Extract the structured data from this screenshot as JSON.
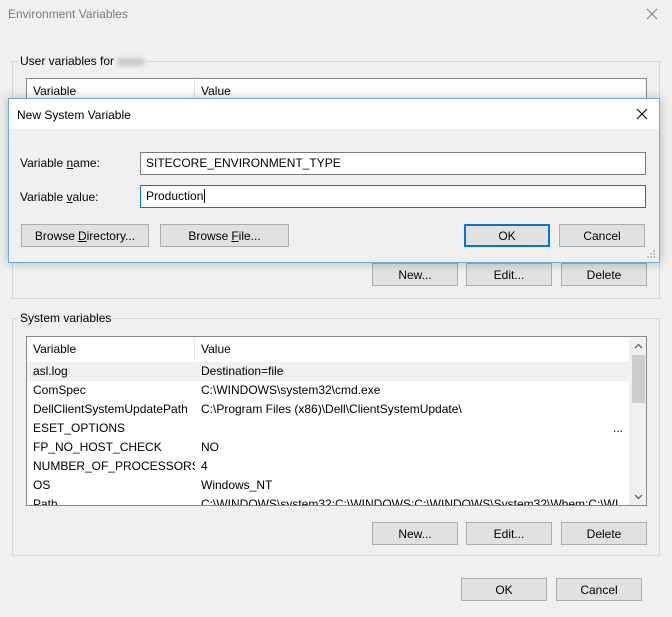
{
  "window": {
    "title": "Environment Variables"
  },
  "user_vars": {
    "group_label": "User variables for",
    "columns": [
      "Variable",
      "Value"
    ],
    "buttons": {
      "new": "New...",
      "edit": "Edit...",
      "delete": "Delete"
    }
  },
  "system_vars": {
    "group_label": "System variables",
    "columns": [
      "Variable",
      "Value"
    ],
    "rows": [
      {
        "variable": "asl.log",
        "value": "Destination=file"
      },
      {
        "variable": "ComSpec",
        "value": "C:\\WINDOWS\\system32\\cmd.exe"
      },
      {
        "variable": "DellClientSystemUpdatePath",
        "value": "C:\\Program Files (x86)\\Dell\\ClientSystemUpdate\\"
      },
      {
        "variable": "ESET_OPTIONS",
        "value": "..."
      },
      {
        "variable": "FP_NO_HOST_CHECK",
        "value": "NO"
      },
      {
        "variable": "NUMBER_OF_PROCESSORS",
        "value": "4"
      },
      {
        "variable": "OS",
        "value": "Windows_NT"
      },
      {
        "variable": "Path",
        "value": "C:\\WINDOWS\\system32;C:\\WINDOWS;C:\\WINDOWS\\System32\\Wbem;C:\\WI..."
      }
    ],
    "buttons": {
      "new": "New...",
      "edit": "Edit...",
      "delete": "Delete"
    }
  },
  "footer": {
    "ok": "OK",
    "cancel": "Cancel"
  },
  "dialog": {
    "title": "New System Variable",
    "name_label": "Variable name:",
    "value_label": "Variable value:",
    "name_value": "SITECORE_ENVIRONMENT_TYPE",
    "value_value": "Production",
    "browse_directory": "Browse Directory...",
    "browse_file": "Browse File...",
    "ok": "OK",
    "cancel": "Cancel"
  },
  "colors": {
    "accent": "#0078d7",
    "dialog_border": "#6bace5",
    "window_bg": "#f0f0f0"
  },
  "icons": {
    "window_close": "close-icon",
    "dialog_close": "close-icon",
    "scroll_up": "chevron-up-icon",
    "scroll_down": "chevron-down-icon",
    "resize": "resize-grip-icon"
  }
}
